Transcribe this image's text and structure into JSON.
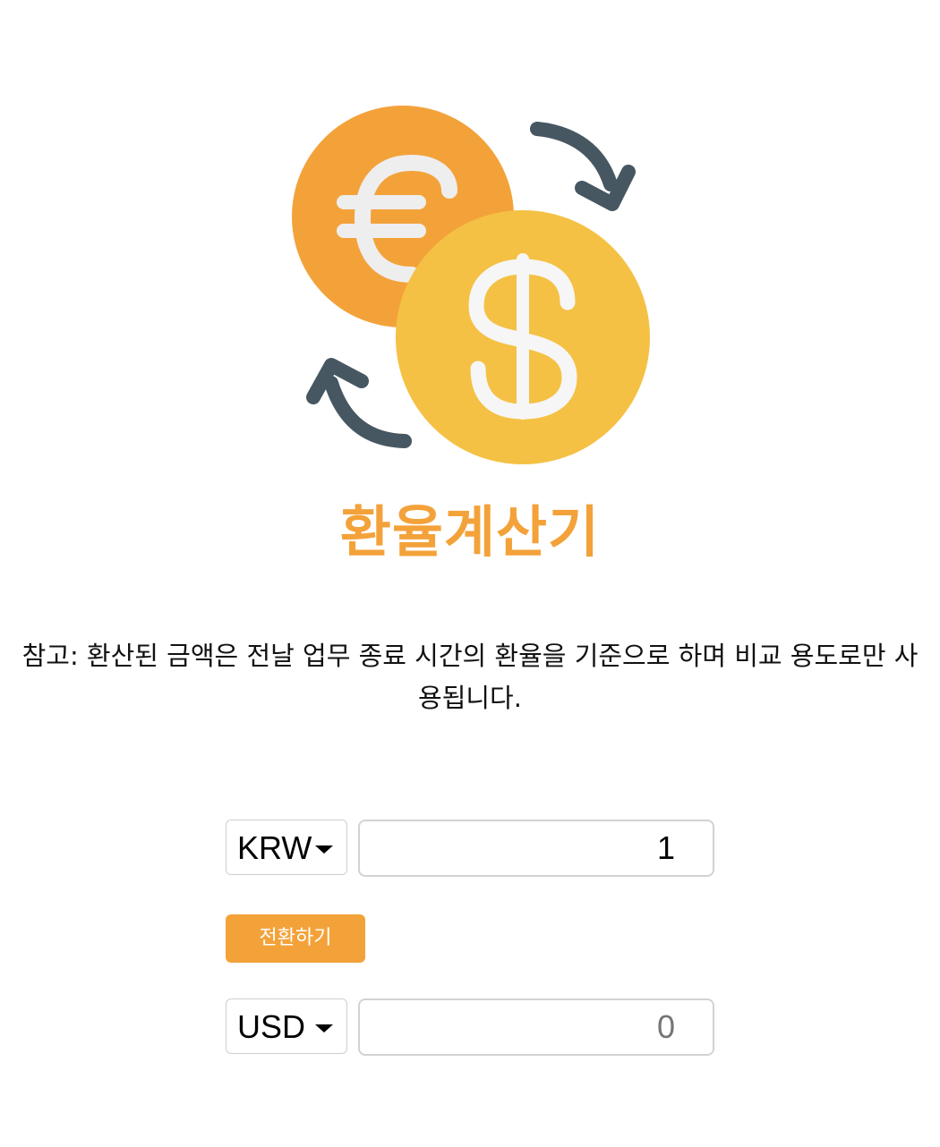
{
  "app": {
    "title": "환율계산기",
    "accent_color": "#f3a23a"
  },
  "logo": {
    "icon": "currency-exchange-icon",
    "coins": [
      "euro-coin-icon",
      "dollar-coin-icon"
    ],
    "arrows": [
      "arrow-clockwise-icon",
      "arrow-counterclockwise-icon"
    ],
    "colors": {
      "euro_coin": "#f3a23a",
      "dollar_coin": "#f5c144",
      "symbol": "#eeeeef",
      "arrow": "#475762"
    }
  },
  "note": {
    "text": "참고: 환산된 금액은 전날 업무 종료 시간의 환율을 기준으로 하며 비교 용도로만 사용됩니다."
  },
  "converter": {
    "from": {
      "currency": "KRW",
      "amount": "1"
    },
    "convert_label": "전환하기",
    "to": {
      "currency": "USD",
      "amount": "0"
    }
  }
}
